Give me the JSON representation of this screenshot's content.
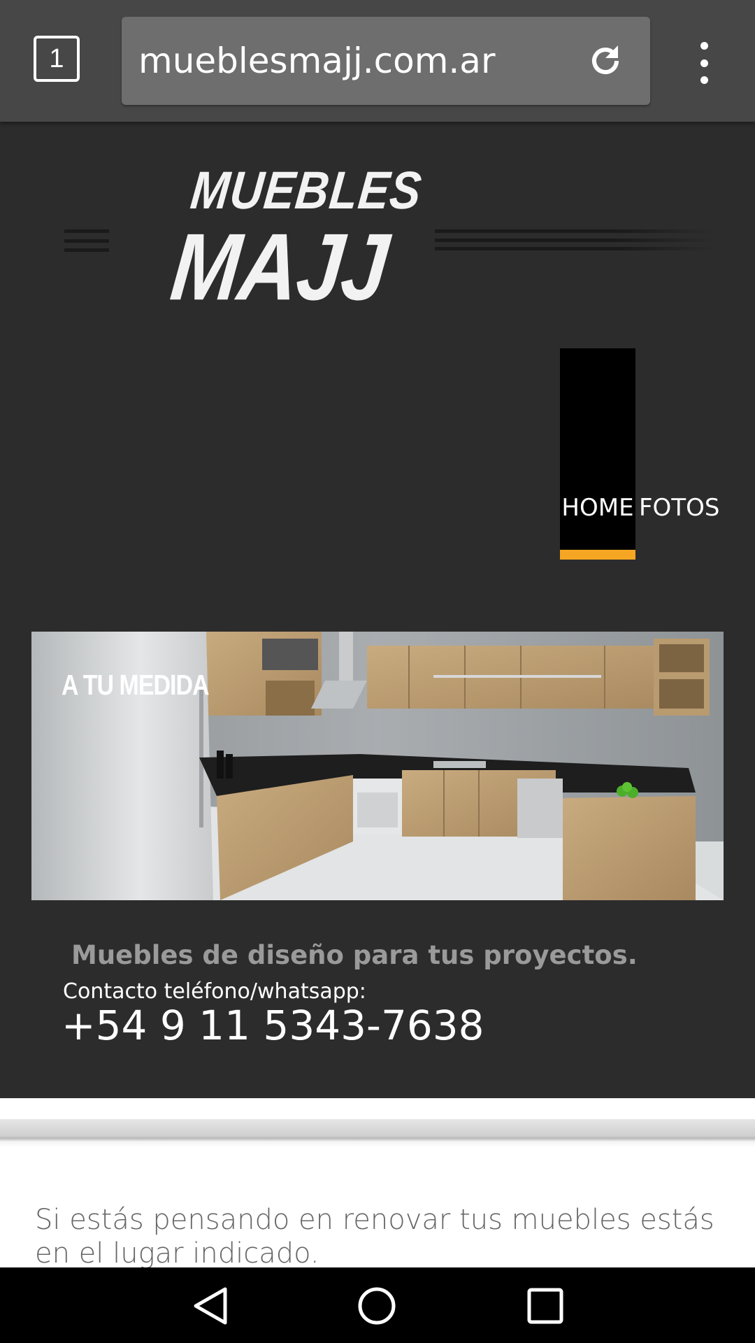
{
  "browser": {
    "tab_count": "1",
    "url": "mueblesmajj.com.ar",
    "reload_icon": "reload-icon",
    "menu_icon": "more-vert-icon"
  },
  "header": {
    "logo": {
      "line1": "MUEBLES",
      "line2": "MAJJ"
    },
    "menu_icon": "hamburger-icon",
    "nav": [
      {
        "label": "HOME",
        "active": true
      },
      {
        "label": "FOTOS",
        "active": false
      }
    ],
    "accent_color": "#f5a623"
  },
  "hero": {
    "image_caption": "A TU MEDIDA",
    "tagline": "Muebles de diseño para tus proyectos.",
    "contact_label": "Contacto teléfono/whatsapp:",
    "phone": "+54 9 11 5343-7638"
  },
  "content": {
    "intro": "Si estás pensando en renovar tus muebles estás en el lugar indicado."
  },
  "system_nav": {
    "back_icon": "back-triangle-icon",
    "home_icon": "home-circle-icon",
    "recents_icon": "recents-square-icon"
  }
}
